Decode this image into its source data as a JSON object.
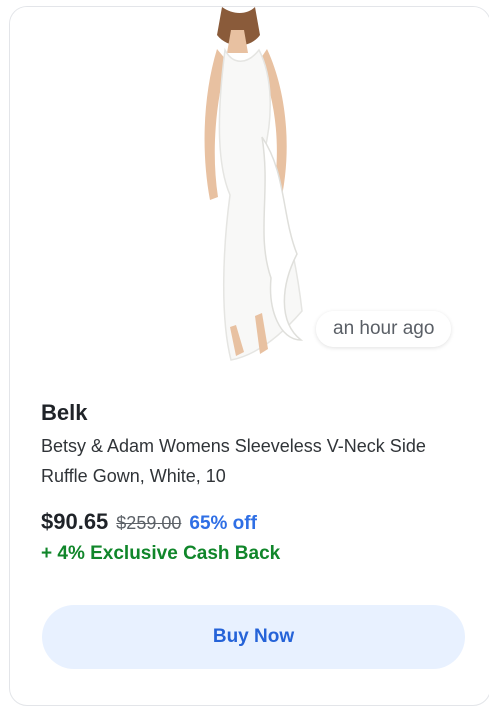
{
  "card": {
    "time_ago": "an hour ago",
    "merchant": "Belk",
    "product_title": "Betsy & Adam Womens Sleeveless V-Neck Side Ruffle Gown, White, 10",
    "price": "$90.65",
    "original_price": "$259.00",
    "discount": "65% off",
    "cashback": "+ 4% Exclusive Cash Back",
    "buy_button_label": "Buy Now"
  },
  "colors": {
    "discount": "#2f6fe5",
    "cashback": "#10862a",
    "button_bg": "#e8f1ff",
    "button_text": "#2563d8"
  }
}
